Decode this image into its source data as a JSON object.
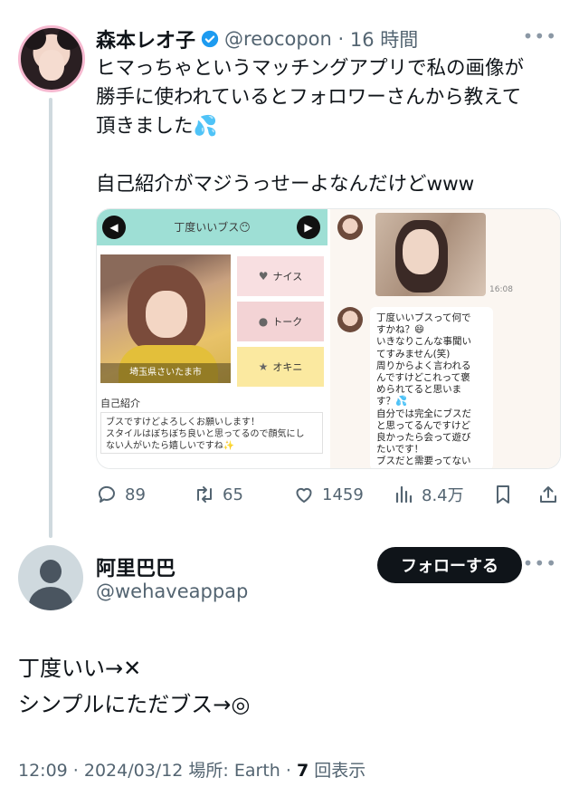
{
  "tweet1": {
    "author_name": "森本レオ子",
    "handle": "@reocopon",
    "time": "16 時間",
    "lines": [
      "ヒマっちゃというマッチングアプリで私の画像が",
      "勝手に使われているとフォロワーさんから教えて",
      "頂きました💦",
      "",
      "自己紹介がマジうっせーよなんだけどwww"
    ],
    "media": {
      "app_title": "丁度いいブス😶",
      "location": "埼玉県さいたま市",
      "nice_label": "ナイス",
      "talk_label": "トーク",
      "fav_label": "オキニ",
      "intro_label": "自己紹介",
      "intro_text": "ブスですけどよろしくお願いします！\nスタイルはぼちぼち良いと思ってるので顔気にし\nない人がいたら嬉しいですね✨",
      "chat_time": "16:08",
      "chat_message": "丁度いいブスって何で\nすかね？😄\nいきなりこんな事聞い\nてすみません(笑)\n周りからよく言われる\nんですけどこれって褒\nめられてると思いま\nす？💦\n自分では完全にブスだ\nと思ってるんですけど\n良かったら会って遊び\nたいです！\nブスだと需要ってない"
    },
    "stats": {
      "replies": "89",
      "retweets": "65",
      "likes": "1459",
      "views": "8.4万"
    }
  },
  "tweet2": {
    "author_name": "阿里巴巴",
    "handle": "@wehaveappap",
    "follow_label": "フォローする",
    "text_lines": [
      "丁度いい→✕",
      "シンプルにただブス→◎"
    ],
    "meta_prefix": "12:09 · 2024/03/12 場所: Earth · ",
    "view_count": "7",
    "meta_suffix": " 回表示"
  },
  "colors": {
    "accent": "#1d9bf0",
    "muted_text": "#536471",
    "follow_button": "#0f1419"
  },
  "icons": [
    "verified-badge-icon",
    "more-icon",
    "reply-icon",
    "retweet-icon",
    "like-icon",
    "views-icon",
    "bookmark-icon",
    "share-icon",
    "default-avatar-icon"
  ]
}
